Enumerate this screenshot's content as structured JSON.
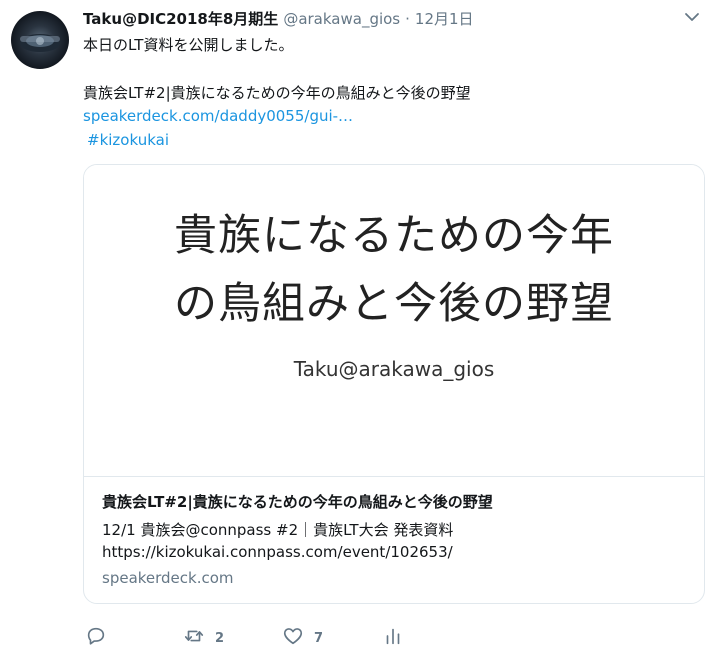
{
  "tweet": {
    "display_name": "Taku@DIC2018年8月期生",
    "handle": "@arakawa_gios",
    "separator": "·",
    "date": "12月1日",
    "text_line1": "本日のLT資料を公開しました。",
    "text_line2": "貴族会LT#2|貴族になるための今年の鳥組みと今後の野望",
    "link": "speakerdeck.com/daddy0055/gui-…",
    "hashtag": "#kizokukai"
  },
  "card": {
    "slide_title_line1": "貴族になるための今年",
    "slide_title_line2": "の鳥組みと今後の野望",
    "slide_author": "Taku@arakawa_gios",
    "title": "貴族会LT#2|貴族になるための今年の鳥組みと今後の野望",
    "desc_line1": "12/1 貴族会@connpass #2｜貴族LT大会 発表資料",
    "desc_line2": "https://kizokukai.connpass.com/event/102653/",
    "domain": "speakerdeck.com"
  },
  "actions": {
    "reply_icon": "reply-icon",
    "retweet_icon": "retweet-icon",
    "retweet_count": "2",
    "like_icon": "heart-icon",
    "like_count": "7",
    "analytics_icon": "analytics-icon"
  },
  "colors": {
    "link": "#1b95e0",
    "secondary_text": "#657786",
    "border": "#e1e8ed"
  }
}
